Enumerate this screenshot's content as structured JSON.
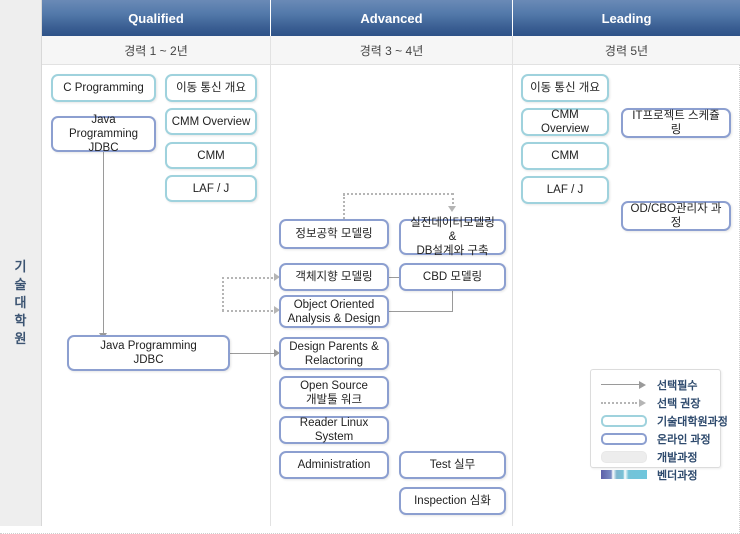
{
  "rail": {
    "label_chars": [
      "기",
      "술",
      "대",
      "학",
      "원"
    ]
  },
  "columns": [
    {
      "title": "Qualified",
      "subtitle": "경력 1 ~ 2년"
    },
    {
      "title": "Advanced",
      "subtitle": "경력 3 ~ 4년"
    },
    {
      "title": "Leading",
      "subtitle": "경력 5년"
    }
  ],
  "boxes": {
    "c_programming": "C Programming",
    "mobile_comm_intro_q": "이동 통신 개요",
    "java_jdbc_top": "Java Programming\nJDBC",
    "cmm_overview_q": "CMM Overview",
    "cmm_q": "CMM",
    "laf_j_q": "LAF / J",
    "java_jdbc_bottom": "Java Programming\nJDBC",
    "info_eng_modeling": "정보공학 모델링",
    "practical_data_modeling": "실전데이터모델링 &\nDB설계와 구축",
    "oo_modeling": "객체지향 모델링",
    "cbd_modeling": "CBD 모델링",
    "ooad": "Object Oriented\nAnalysis & Design",
    "design_patterns": "Design Parents &\nRelactoring",
    "open_source": "Open Source\n개발툴 워크",
    "reader_linux": "Reader Linux System",
    "administration": "Administration",
    "test_practice": "Test 실무",
    "inspection_adv": "Inspection 심화",
    "mobile_comm_intro_l": "이동 통신 개요",
    "cmm_overview_l": "CMM Overview",
    "cmm_l": "CMM",
    "laf_j_l": "LAF / J",
    "it_project_scheduling": "IT프로젝트 스케쥴링",
    "od_cbo_manager": "OD/CBO관리자 과정"
  },
  "legend": [
    {
      "symbol": "solid-arrow",
      "label": "선택필수"
    },
    {
      "symbol": "dotted-arrow",
      "label": "선택 권장"
    },
    {
      "symbol": "grad-box",
      "label": "기술대학원과정"
    },
    {
      "symbol": "online-box",
      "label": "온라인 과정"
    },
    {
      "symbol": "dev-box",
      "label": "개발과정"
    },
    {
      "symbol": "vendor-bar",
      "label": "벤더과정"
    }
  ],
  "colors": {
    "header_top": "#6a8ab6",
    "header_bottom": "#2e5287",
    "grad_border": "#9fd2dd",
    "online_border": "#8c9fd0",
    "rail_bg": "#eeeeee",
    "connector": "#9a9a9a",
    "connector_dotted": "#b5b5b5"
  }
}
